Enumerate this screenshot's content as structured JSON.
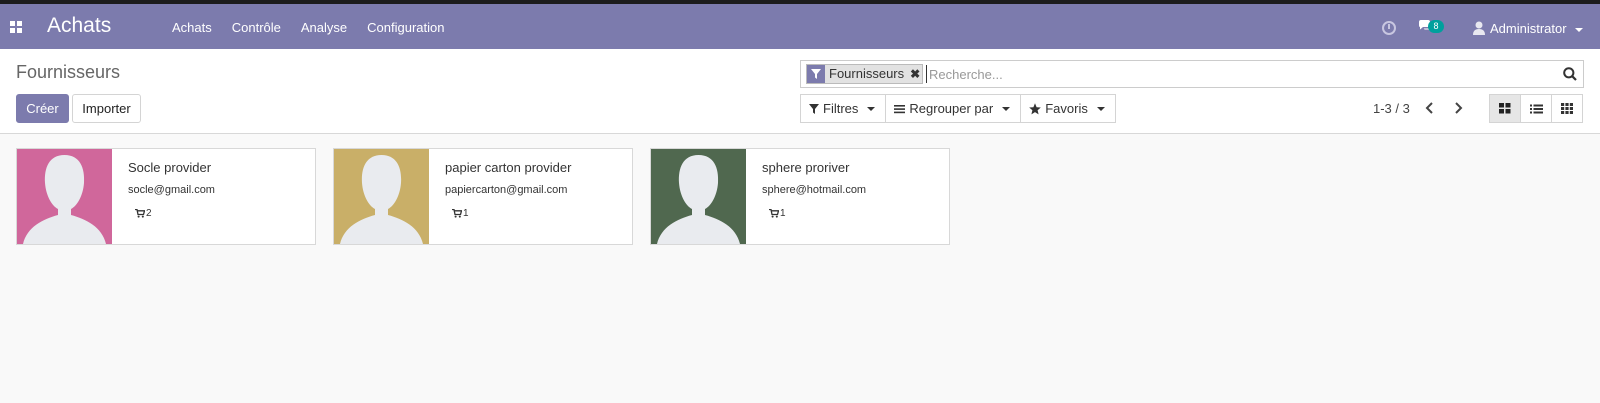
{
  "navbar": {
    "app_title": "Achats",
    "menu": [
      "Achats",
      "Contrôle",
      "Analyse",
      "Configuration"
    ],
    "chat_count": "8",
    "user": "Administrator"
  },
  "control": {
    "breadcrumb": "Fournisseurs",
    "create_label": "Créer",
    "import_label": "Importer",
    "search": {
      "facet": "Fournisseurs",
      "placeholder": "Recherche..."
    },
    "filters_label": "Filtres",
    "group_label": "Regrouper par",
    "favorites_label": "Favoris",
    "pager": "1-3 / 3"
  },
  "colors": {
    "brand": "#7c7bad",
    "badge": "#00a09d"
  },
  "vendors": [
    {
      "name": "Socle provider",
      "email": "socle@gmail.com",
      "count": "2",
      "avatar_color": "#d0679b"
    },
    {
      "name": "papier carton provider",
      "email": "papiercarton@gmail.com",
      "count": "1",
      "avatar_color": "#c9af68"
    },
    {
      "name": "sphere proriver",
      "email": "sphere@hotmail.com",
      "count": "1",
      "avatar_color": "#50684f"
    }
  ]
}
